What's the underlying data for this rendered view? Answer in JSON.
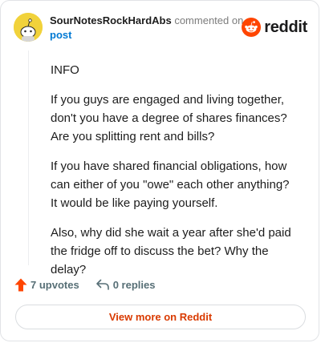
{
  "author": {
    "username": "SourNotesRockHardAbs",
    "commented_text": "commented on",
    "post_link": "post"
  },
  "brand": {
    "name": "reddit",
    "color": "#ff4500"
  },
  "comment": {
    "paragraphs": [
      "INFO",
      "If you guys are engaged and living together, don't you have a degree of shares finances? Are you splitting rent and bills?",
      "If you have shared financial obligations, how can either of you \"owe\" each other anything? It would be like paying yourself.",
      "Also, why did she wait a year after she'd paid the fridge off to discuss the bet? Why the delay?"
    ]
  },
  "actions": {
    "upvotes_label": "7 upvotes",
    "replies_label": "0 replies"
  },
  "footer": {
    "view_button_label": "View more on Reddit"
  },
  "icons": {
    "avatar": "snoo-avatar-icon",
    "brand": "reddit-logo-icon",
    "upvote": "upvote-arrow-icon",
    "reply": "reply-arrow-icon"
  }
}
